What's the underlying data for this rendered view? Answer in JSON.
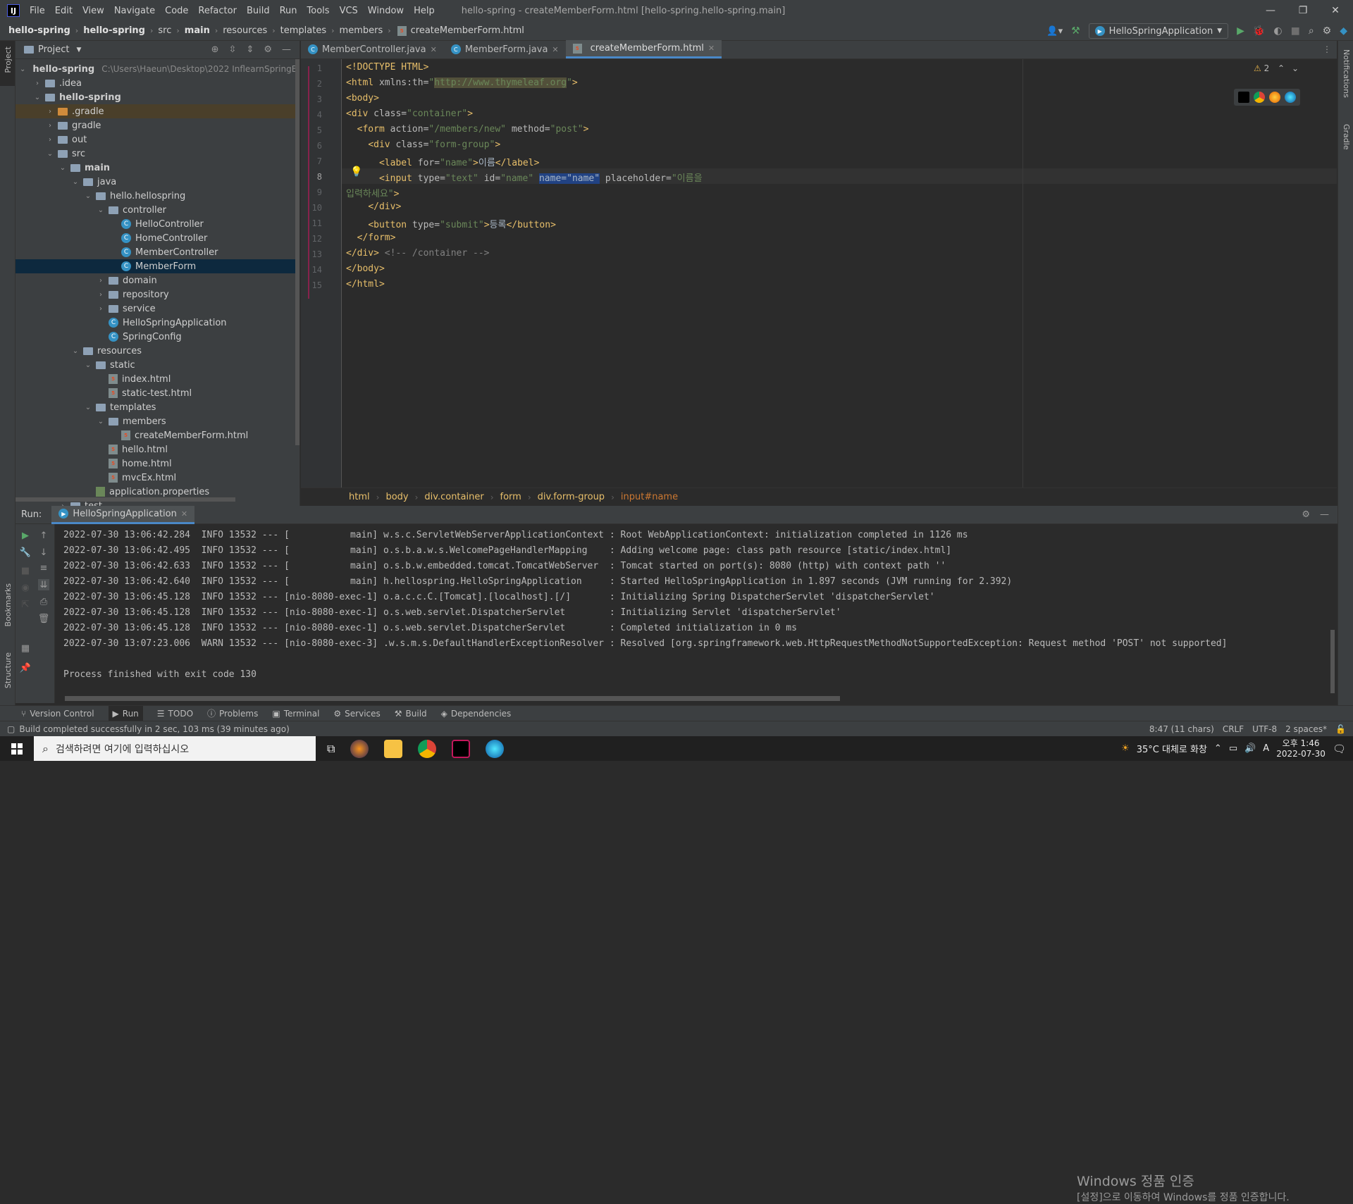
{
  "menubar": {
    "app_icon": "intellij-logo",
    "items": [
      "File",
      "Edit",
      "View",
      "Navigate",
      "Code",
      "Refactor",
      "Build",
      "Run",
      "Tools",
      "VCS",
      "Window",
      "Help"
    ],
    "window_title": "hello-spring - createMemberForm.html [hello-spring.hello-spring.main]"
  },
  "navbar": {
    "crumbs": [
      "hello-spring",
      "hello-spring",
      "src",
      "main",
      "resources",
      "templates",
      "members",
      "createMemberForm.html"
    ],
    "run_config": "HelloSpringApplication"
  },
  "project": {
    "title": "Project",
    "tree": [
      {
        "label": "hello-spring",
        "indent": 0,
        "type": "folder",
        "open": true,
        "bold": true,
        "path": "C:\\Users\\Haeun\\Desktop\\2022 InflearnSpringBasic"
      },
      {
        "label": ".idea",
        "indent": 1,
        "type": "folder",
        "open": false
      },
      {
        "label": "hello-spring",
        "indent": 1,
        "type": "folder",
        "open": true,
        "bold": true
      },
      {
        "label": ".gradle",
        "indent": 2,
        "type": "folder-orange",
        "open": false,
        "hl": "gradle"
      },
      {
        "label": "gradle",
        "indent": 2,
        "type": "folder",
        "open": false
      },
      {
        "label": "out",
        "indent": 2,
        "type": "folder",
        "open": false
      },
      {
        "label": "src",
        "indent": 2,
        "type": "folder",
        "open": true
      },
      {
        "label": "main",
        "indent": 3,
        "type": "folder",
        "open": true,
        "bold": true
      },
      {
        "label": "java",
        "indent": 4,
        "type": "folder",
        "open": true
      },
      {
        "label": "hello.hellospring",
        "indent": 5,
        "type": "folder",
        "open": true
      },
      {
        "label": "controller",
        "indent": 6,
        "type": "folder",
        "open": true
      },
      {
        "label": "HelloController",
        "indent": 7,
        "type": "class"
      },
      {
        "label": "HomeController",
        "indent": 7,
        "type": "class"
      },
      {
        "label": "MemberController",
        "indent": 7,
        "type": "class"
      },
      {
        "label": "MemberForm",
        "indent": 7,
        "type": "class",
        "hl": "sel"
      },
      {
        "label": "domain",
        "indent": 6,
        "type": "folder",
        "open": false
      },
      {
        "label": "repository",
        "indent": 6,
        "type": "folder",
        "open": false
      },
      {
        "label": "service",
        "indent": 6,
        "type": "folder",
        "open": false
      },
      {
        "label": "HelloSpringApplication",
        "indent": 6,
        "type": "class"
      },
      {
        "label": "SpringConfig",
        "indent": 6,
        "type": "class"
      },
      {
        "label": "resources",
        "indent": 4,
        "type": "folder",
        "open": true
      },
      {
        "label": "static",
        "indent": 5,
        "type": "folder",
        "open": true
      },
      {
        "label": "index.html",
        "indent": 6,
        "type": "html"
      },
      {
        "label": "static-test.html",
        "indent": 6,
        "type": "html"
      },
      {
        "label": "templates",
        "indent": 5,
        "type": "folder",
        "open": true
      },
      {
        "label": "members",
        "indent": 6,
        "type": "folder",
        "open": true
      },
      {
        "label": "createMemberForm.html",
        "indent": 7,
        "type": "html"
      },
      {
        "label": "hello.html",
        "indent": 6,
        "type": "html"
      },
      {
        "label": "home.html",
        "indent": 6,
        "type": "html"
      },
      {
        "label": "mvcEx.html",
        "indent": 6,
        "type": "html"
      },
      {
        "label": "application.properties",
        "indent": 5,
        "type": "prop"
      },
      {
        "label": "test",
        "indent": 3,
        "type": "folder",
        "open": false
      }
    ]
  },
  "tabs": [
    {
      "label": "MemberController.java",
      "active": false
    },
    {
      "label": "MemberForm.java",
      "active": false
    },
    {
      "label": "createMemberForm.html",
      "active": true
    }
  ],
  "editor": {
    "warning_count": "2",
    "breadcrumbs": [
      "html",
      "body",
      "div.container",
      "form",
      "div.form-group",
      "input#name"
    ]
  },
  "run": {
    "label": "Run:",
    "tab": "HelloSpringApplication",
    "log": [
      "2022-07-30 13:06:42.284  INFO 13532 --- [           main] w.s.c.ServletWebServerApplicationContext : Root WebApplicationContext: initialization completed in 1126 ms",
      "2022-07-30 13:06:42.495  INFO 13532 --- [           main] o.s.b.a.w.s.WelcomePageHandlerMapping    : Adding welcome page: class path resource [static/index.html]",
      "2022-07-30 13:06:42.633  INFO 13532 --- [           main] o.s.b.w.embedded.tomcat.TomcatWebServer  : Tomcat started on port(s): 8080 (http) with context path ''",
      "2022-07-30 13:06:42.640  INFO 13532 --- [           main] h.hellospring.HelloSpringApplication     : Started HelloSpringApplication in 1.897 seconds (JVM running for 2.392)",
      "2022-07-30 13:06:45.128  INFO 13532 --- [nio-8080-exec-1] o.a.c.c.C.[Tomcat].[localhost].[/]       : Initializing Spring DispatcherServlet 'dispatcherServlet'",
      "2022-07-30 13:06:45.128  INFO 13532 --- [nio-8080-exec-1] o.s.web.servlet.DispatcherServlet        : Initializing Servlet 'dispatcherServlet'",
      "2022-07-30 13:06:45.128  INFO 13532 --- [nio-8080-exec-1] o.s.web.servlet.DispatcherServlet        : Completed initialization in 0 ms",
      "2022-07-30 13:07:23.006  WARN 13532 --- [nio-8080-exec-3] .w.s.m.s.DefaultHandlerExceptionResolver : Resolved [org.springframework.web.HttpRequestMethodNotSupportedException: Request method 'POST' not supported]",
      "",
      "Process finished with exit code 130"
    ],
    "windows_activation_title": "Windows 정품 인증",
    "windows_activation_sub": "[설정]으로 이동하여 Windows를 정품 인증합니다."
  },
  "bottom_tabs": [
    "Version Control",
    "Run",
    "TODO",
    "Problems",
    "Terminal",
    "Services",
    "Build",
    "Dependencies"
  ],
  "side_labels": {
    "project": "Project",
    "bookmarks": "Bookmarks",
    "structure": "Structure",
    "notifications": "Notifications",
    "gradle": "Gradle"
  },
  "status": {
    "message": "Build completed successfully in 2 sec, 103 ms (39 minutes ago)",
    "position": "8:47 (11 chars)",
    "line_sep": "CRLF",
    "encoding": "UTF-8",
    "indent": "2 spaces*"
  },
  "taskbar": {
    "search_placeholder": "검색하려면 여기에 입력하십시오",
    "weather": "35°C  대체로 화창",
    "time": "오후 1:46",
    "date": "2022-07-30",
    "ime": "A"
  },
  "colors": {
    "accent": "#4a88c7",
    "selection": "#0d293e",
    "tag": "#e8bf6a",
    "string": "#6a8759"
  }
}
